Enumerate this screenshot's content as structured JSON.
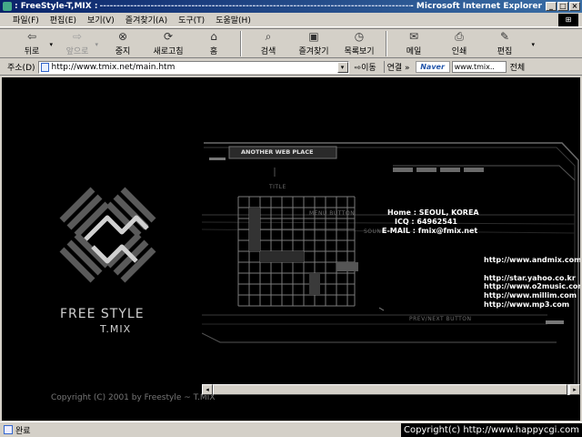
{
  "window": {
    "title_left": ": FreeStyle-T,MIX :",
    "title_dashes": "---------------------------------------------------------------------------------------------------",
    "title_right": "- Microsoft Internet Explorer",
    "btn_min": "_",
    "btn_max": "□",
    "btn_close": "×"
  },
  "menu": {
    "items": [
      "파일(F)",
      "편집(E)",
      "보기(V)",
      "즐겨찾기(A)",
      "도구(T)",
      "도움말(H)"
    ]
  },
  "toolbar": {
    "back": "뒤로",
    "forward": "앞으로",
    "stop": "중지",
    "refresh": "새로고침",
    "home": "홈",
    "search": "검색",
    "favorites": "즐겨찾기",
    "history": "목록보기",
    "mail": "메일",
    "print": "인쇄",
    "edit": "편집"
  },
  "address": {
    "label": "주소(D)",
    "url": "http://www.tmix.net/main.htm",
    "go": "이동",
    "links": "연결",
    "naver": "Naver",
    "naver_field": "www.tmix..",
    "whole": "전체"
  },
  "page": {
    "logo_line1": "FREE STYLE",
    "logo_line2": "T.MIX",
    "copyright": "Copyright (C) 2001 by Freestyle ~ T.MIX",
    "panel_title": "ANOTHER WEB PLACE",
    "label_title": "TITLE",
    "label_menu": "MENU BUTTON",
    "label_sound": "SOUND",
    "label_prevnext": "PREV/NEXT BUTTON",
    "home_line": "Home : SEOUL, KOREA",
    "icq_line": "ICQ : 64962541",
    "email_line": "E-MAIL : fmix@fmix.net",
    "link_main": "http://www.andmix.com",
    "links": [
      "http://star.yahoo.co.kr",
      "http://www.o2music.com",
      "http://www.millim.com",
      "http://www.mp3.com"
    ]
  },
  "status": {
    "text": "완료",
    "watermark": "Copyright(c) http://www.happycgi.com"
  }
}
